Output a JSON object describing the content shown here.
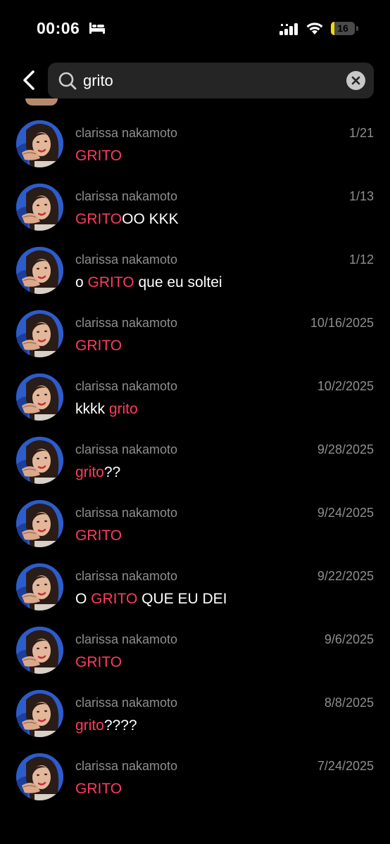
{
  "status_bar": {
    "time": "00:06",
    "battery_level": "16",
    "battery_fraction": 0.16,
    "icons": [
      "bed-icon",
      "signal-icon",
      "wifi-icon",
      "battery-icon"
    ]
  },
  "search": {
    "query": "grito"
  },
  "colors": {
    "background": "#000000",
    "highlight": "#ff3b5c",
    "secondary_text": "#8e8e8e",
    "search_field": "#252525",
    "battery_fill": "#f5d90a"
  },
  "results": [
    {
      "sender": "clarissa nakamoto",
      "date": "1/21",
      "segments": [
        {
          "text": "GRITO",
          "highlight": true
        }
      ]
    },
    {
      "sender": "clarissa nakamoto",
      "date": "1/13",
      "segments": [
        {
          "text": "GRITO",
          "highlight": true
        },
        {
          "text": "OO KKK",
          "highlight": false
        }
      ]
    },
    {
      "sender": "clarissa nakamoto",
      "date": "1/12",
      "segments": [
        {
          "text": "o ",
          "highlight": false
        },
        {
          "text": "GRITO",
          "highlight": true
        },
        {
          "text": " que eu soltei",
          "highlight": false
        }
      ]
    },
    {
      "sender": "clarissa nakamoto",
      "date": "10/16/2025",
      "segments": [
        {
          "text": "GRITO",
          "highlight": true
        }
      ]
    },
    {
      "sender": "clarissa nakamoto",
      "date": "10/2/2025",
      "segments": [
        {
          "text": "kkkk ",
          "highlight": false
        },
        {
          "text": "grito",
          "highlight": true
        }
      ]
    },
    {
      "sender": "clarissa nakamoto",
      "date": "9/28/2025",
      "segments": [
        {
          "text": "grito",
          "highlight": true
        },
        {
          "text": "??",
          "highlight": false
        }
      ]
    },
    {
      "sender": "clarissa nakamoto",
      "date": "9/24/2025",
      "segments": [
        {
          "text": "GRITO",
          "highlight": true
        }
      ]
    },
    {
      "sender": "clarissa nakamoto",
      "date": "9/22/2025",
      "segments": [
        {
          "text": "O ",
          "highlight": false
        },
        {
          "text": "GRITO",
          "highlight": true
        },
        {
          "text": " QUE EU DEI",
          "highlight": false
        }
      ]
    },
    {
      "sender": "clarissa nakamoto",
      "date": "9/6/2025",
      "segments": [
        {
          "text": "GRITO",
          "highlight": true
        }
      ]
    },
    {
      "sender": "clarissa nakamoto",
      "date": "8/8/2025",
      "segments": [
        {
          "text": "grito",
          "highlight": true
        },
        {
          "text": "????",
          "highlight": false
        }
      ]
    },
    {
      "sender": "clarissa nakamoto",
      "date": "7/24/2025",
      "segments": [
        {
          "text": "GRITO",
          "highlight": true
        }
      ]
    }
  ]
}
